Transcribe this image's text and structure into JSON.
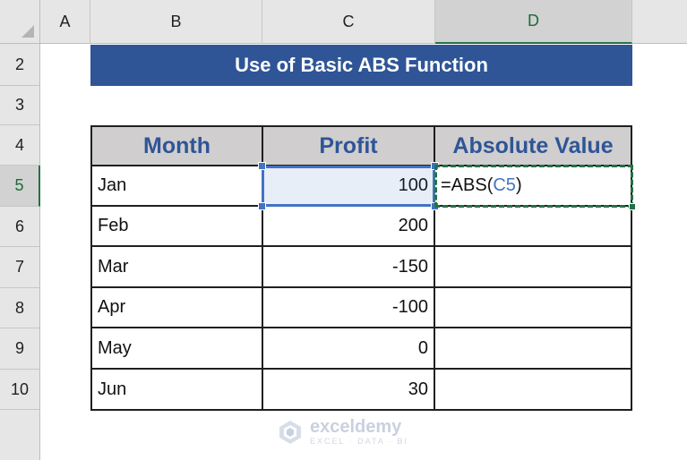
{
  "columns": [
    "A",
    "B",
    "C",
    "D"
  ],
  "active_column": "D",
  "rows": [
    "2",
    "3",
    "4",
    "5",
    "6",
    "7",
    "8",
    "9",
    "10"
  ],
  "active_row": "5",
  "title": "Use of Basic ABS Function",
  "table": {
    "headers": [
      "Month",
      "Profit",
      "Absolute Value"
    ],
    "rows": [
      {
        "month": "Jan",
        "profit": "100"
      },
      {
        "month": "Feb",
        "profit": "200"
      },
      {
        "month": "Mar",
        "profit": "-150"
      },
      {
        "month": "Apr",
        "profit": "-100"
      },
      {
        "month": "May",
        "profit": "0"
      },
      {
        "month": "Jun",
        "profit": "30"
      }
    ]
  },
  "formula": {
    "prefix": "=ABS(",
    "ref": "C5",
    "suffix": ")"
  },
  "selection": {
    "referenced_cell": "C5",
    "editing_cell": "D5"
  },
  "colors": {
    "title_bg": "#2f5597",
    "header_bg": "#d0cece",
    "header_text": "#2f5597",
    "ref_highlight": "#4472c4",
    "active_green": "#217346"
  },
  "watermark": {
    "name": "exceldemy",
    "tagline": "EXCEL · DATA · BI"
  }
}
